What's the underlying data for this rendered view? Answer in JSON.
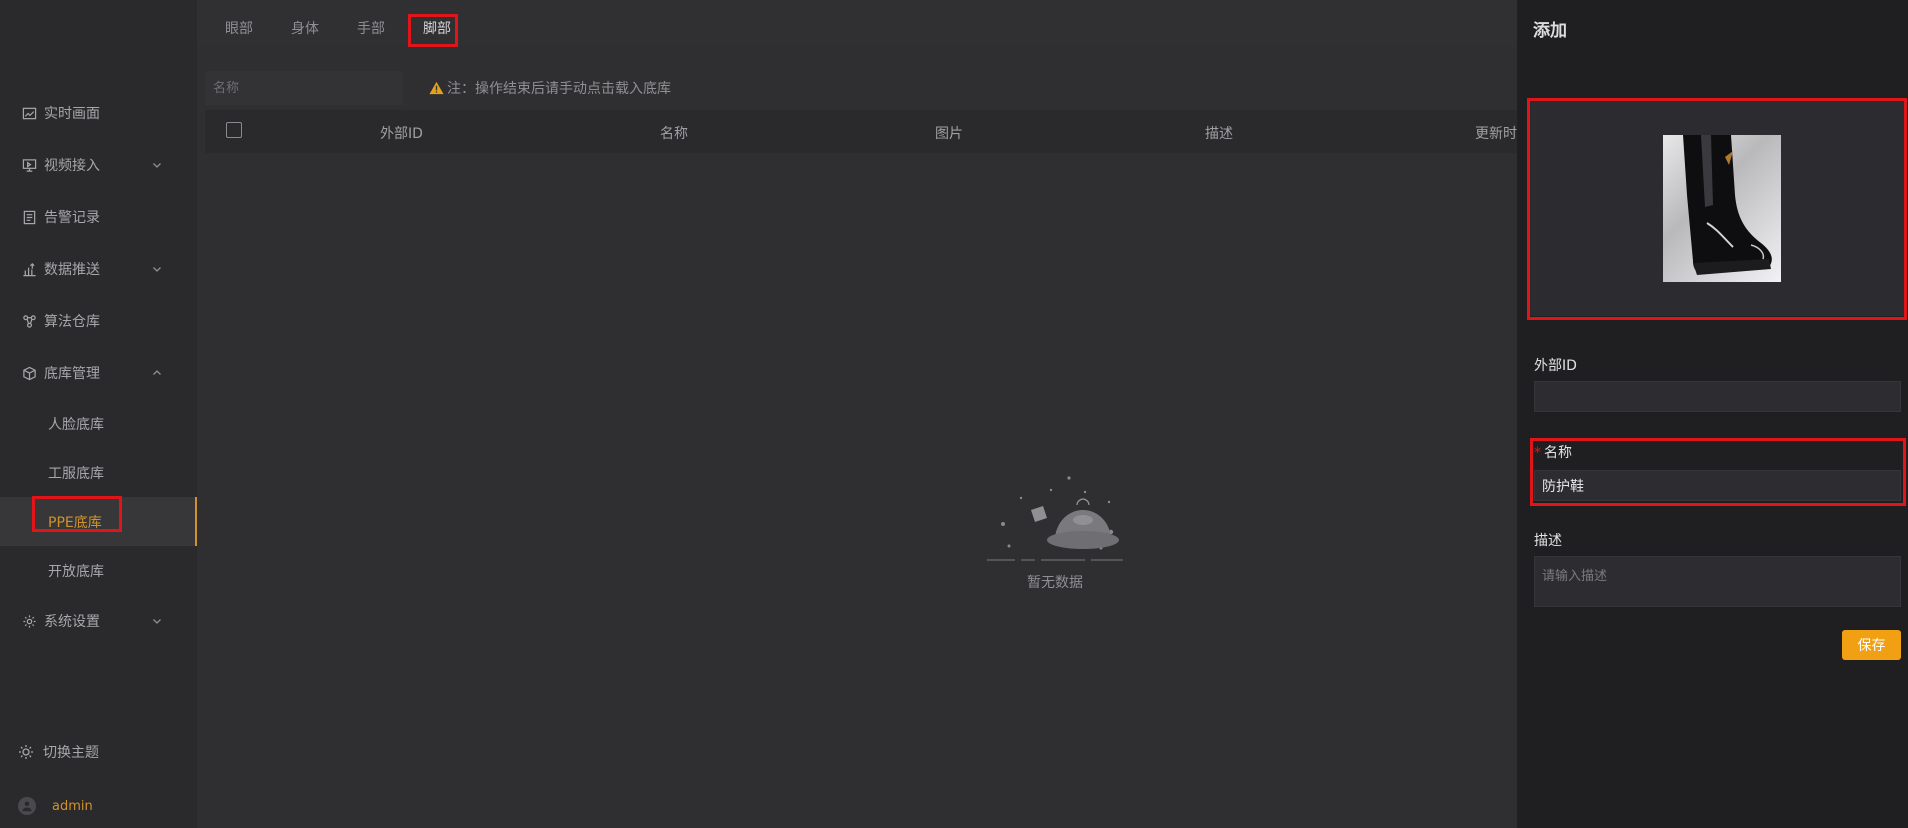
{
  "sidebar": {
    "items": [
      {
        "label": "实时画面",
        "icon": "chart-line-icon"
      },
      {
        "label": "视频接入",
        "icon": "monitor-icon",
        "expandable": true
      },
      {
        "label": "告警记录",
        "icon": "document-icon"
      },
      {
        "label": "数据推送",
        "icon": "bar-upload-icon",
        "expandable": true
      },
      {
        "label": "算法仓库",
        "icon": "algorithm-icon"
      },
      {
        "label": "底库管理",
        "icon": "cube-icon",
        "expanded": true
      },
      {
        "label": "系统设置",
        "icon": "gear-icon",
        "expandable": true
      }
    ],
    "sub_items": [
      "人脸底库",
      "工服底库",
      "PPE底库",
      "开放底库"
    ],
    "active_sub": "PPE底库",
    "theme_toggle": "切换主题",
    "user": "admin"
  },
  "tabs": [
    "眼部",
    "身体",
    "手部",
    "脚部"
  ],
  "active_tab": "脚部",
  "toolbar": {
    "search_placeholder": "名称",
    "note": "注：操作结束后请手动点击载入底库"
  },
  "table": {
    "columns": [
      "外部ID",
      "名称",
      "图片",
      "描述",
      "更新时间"
    ],
    "empty_text": "暂无数据"
  },
  "drawer": {
    "title": "添加",
    "external_id_label": "外部ID",
    "external_id_value": "",
    "name_label": "名称",
    "name_required": "*",
    "name_value": "防护鞋",
    "desc_label": "描述",
    "desc_placeholder": "请输入描述",
    "save_label": "保存"
  },
  "colors": {
    "accent": "#f0a012",
    "active_text": "#d0922a",
    "highlight": "#e0151a"
  }
}
